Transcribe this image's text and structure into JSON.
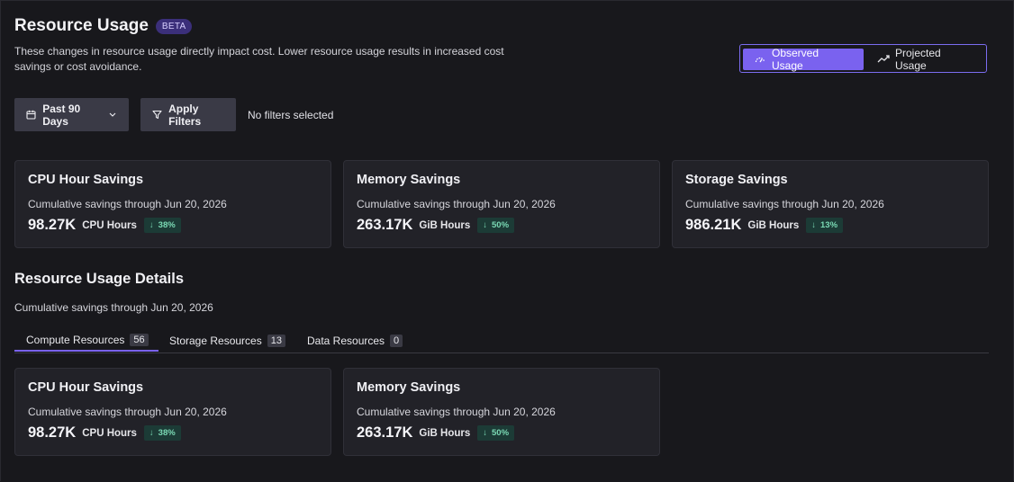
{
  "header": {
    "title": "Resource Usage",
    "beta_label": "BETA",
    "description": "These changes in resource usage directly impact cost. Lower resource usage results in increased cost savings or cost avoidance."
  },
  "view_toggle": {
    "observed_label": "Observed Usage",
    "projected_label": "Projected Usage",
    "selected": "Observed Usage"
  },
  "filters": {
    "date_range_label": "Past 90 Days",
    "apply_label": "Apply Filters",
    "status_text": "No filters selected"
  },
  "summary_cards": [
    {
      "title": "CPU Hour Savings",
      "subtitle": "Cumulative savings through Jun 20, 2026",
      "value": "98.27K",
      "unit": "CPU Hours",
      "change": "38%",
      "trend": "down"
    },
    {
      "title": "Memory Savings",
      "subtitle": "Cumulative savings through Jun 20, 2026",
      "value": "263.17K",
      "unit": "GiB Hours",
      "change": "50%",
      "trend": "down"
    },
    {
      "title": "Storage Savings",
      "subtitle": "Cumulative savings through Jun 20, 2026",
      "value": "986.21K",
      "unit": "GiB Hours",
      "change": "13%",
      "trend": "down"
    }
  ],
  "details": {
    "title": "Resource Usage Details",
    "subtitle": "Cumulative savings through Jun 20, 2026",
    "tabs": [
      {
        "label": "Compute Resources",
        "count": "56",
        "active": true
      },
      {
        "label": "Storage Resources",
        "count": "13",
        "active": false
      },
      {
        "label": "Data Resources",
        "count": "0",
        "active": false
      }
    ],
    "cards": [
      {
        "title": "CPU Hour Savings",
        "subtitle": "Cumulative savings through Jun 20, 2026",
        "value": "98.27K",
        "unit": "CPU Hours",
        "change": "38%",
        "trend": "down"
      },
      {
        "title": "Memory Savings",
        "subtitle": "Cumulative savings through Jun 20, 2026",
        "value": "263.17K",
        "unit": "GiB Hours",
        "change": "50%",
        "trend": "down"
      }
    ]
  },
  "colors": {
    "background": "#18181c",
    "card": "#222228",
    "accent": "#7a62ef",
    "badge_bg": "#1c3b36",
    "badge_text": "#7ad9b4"
  }
}
